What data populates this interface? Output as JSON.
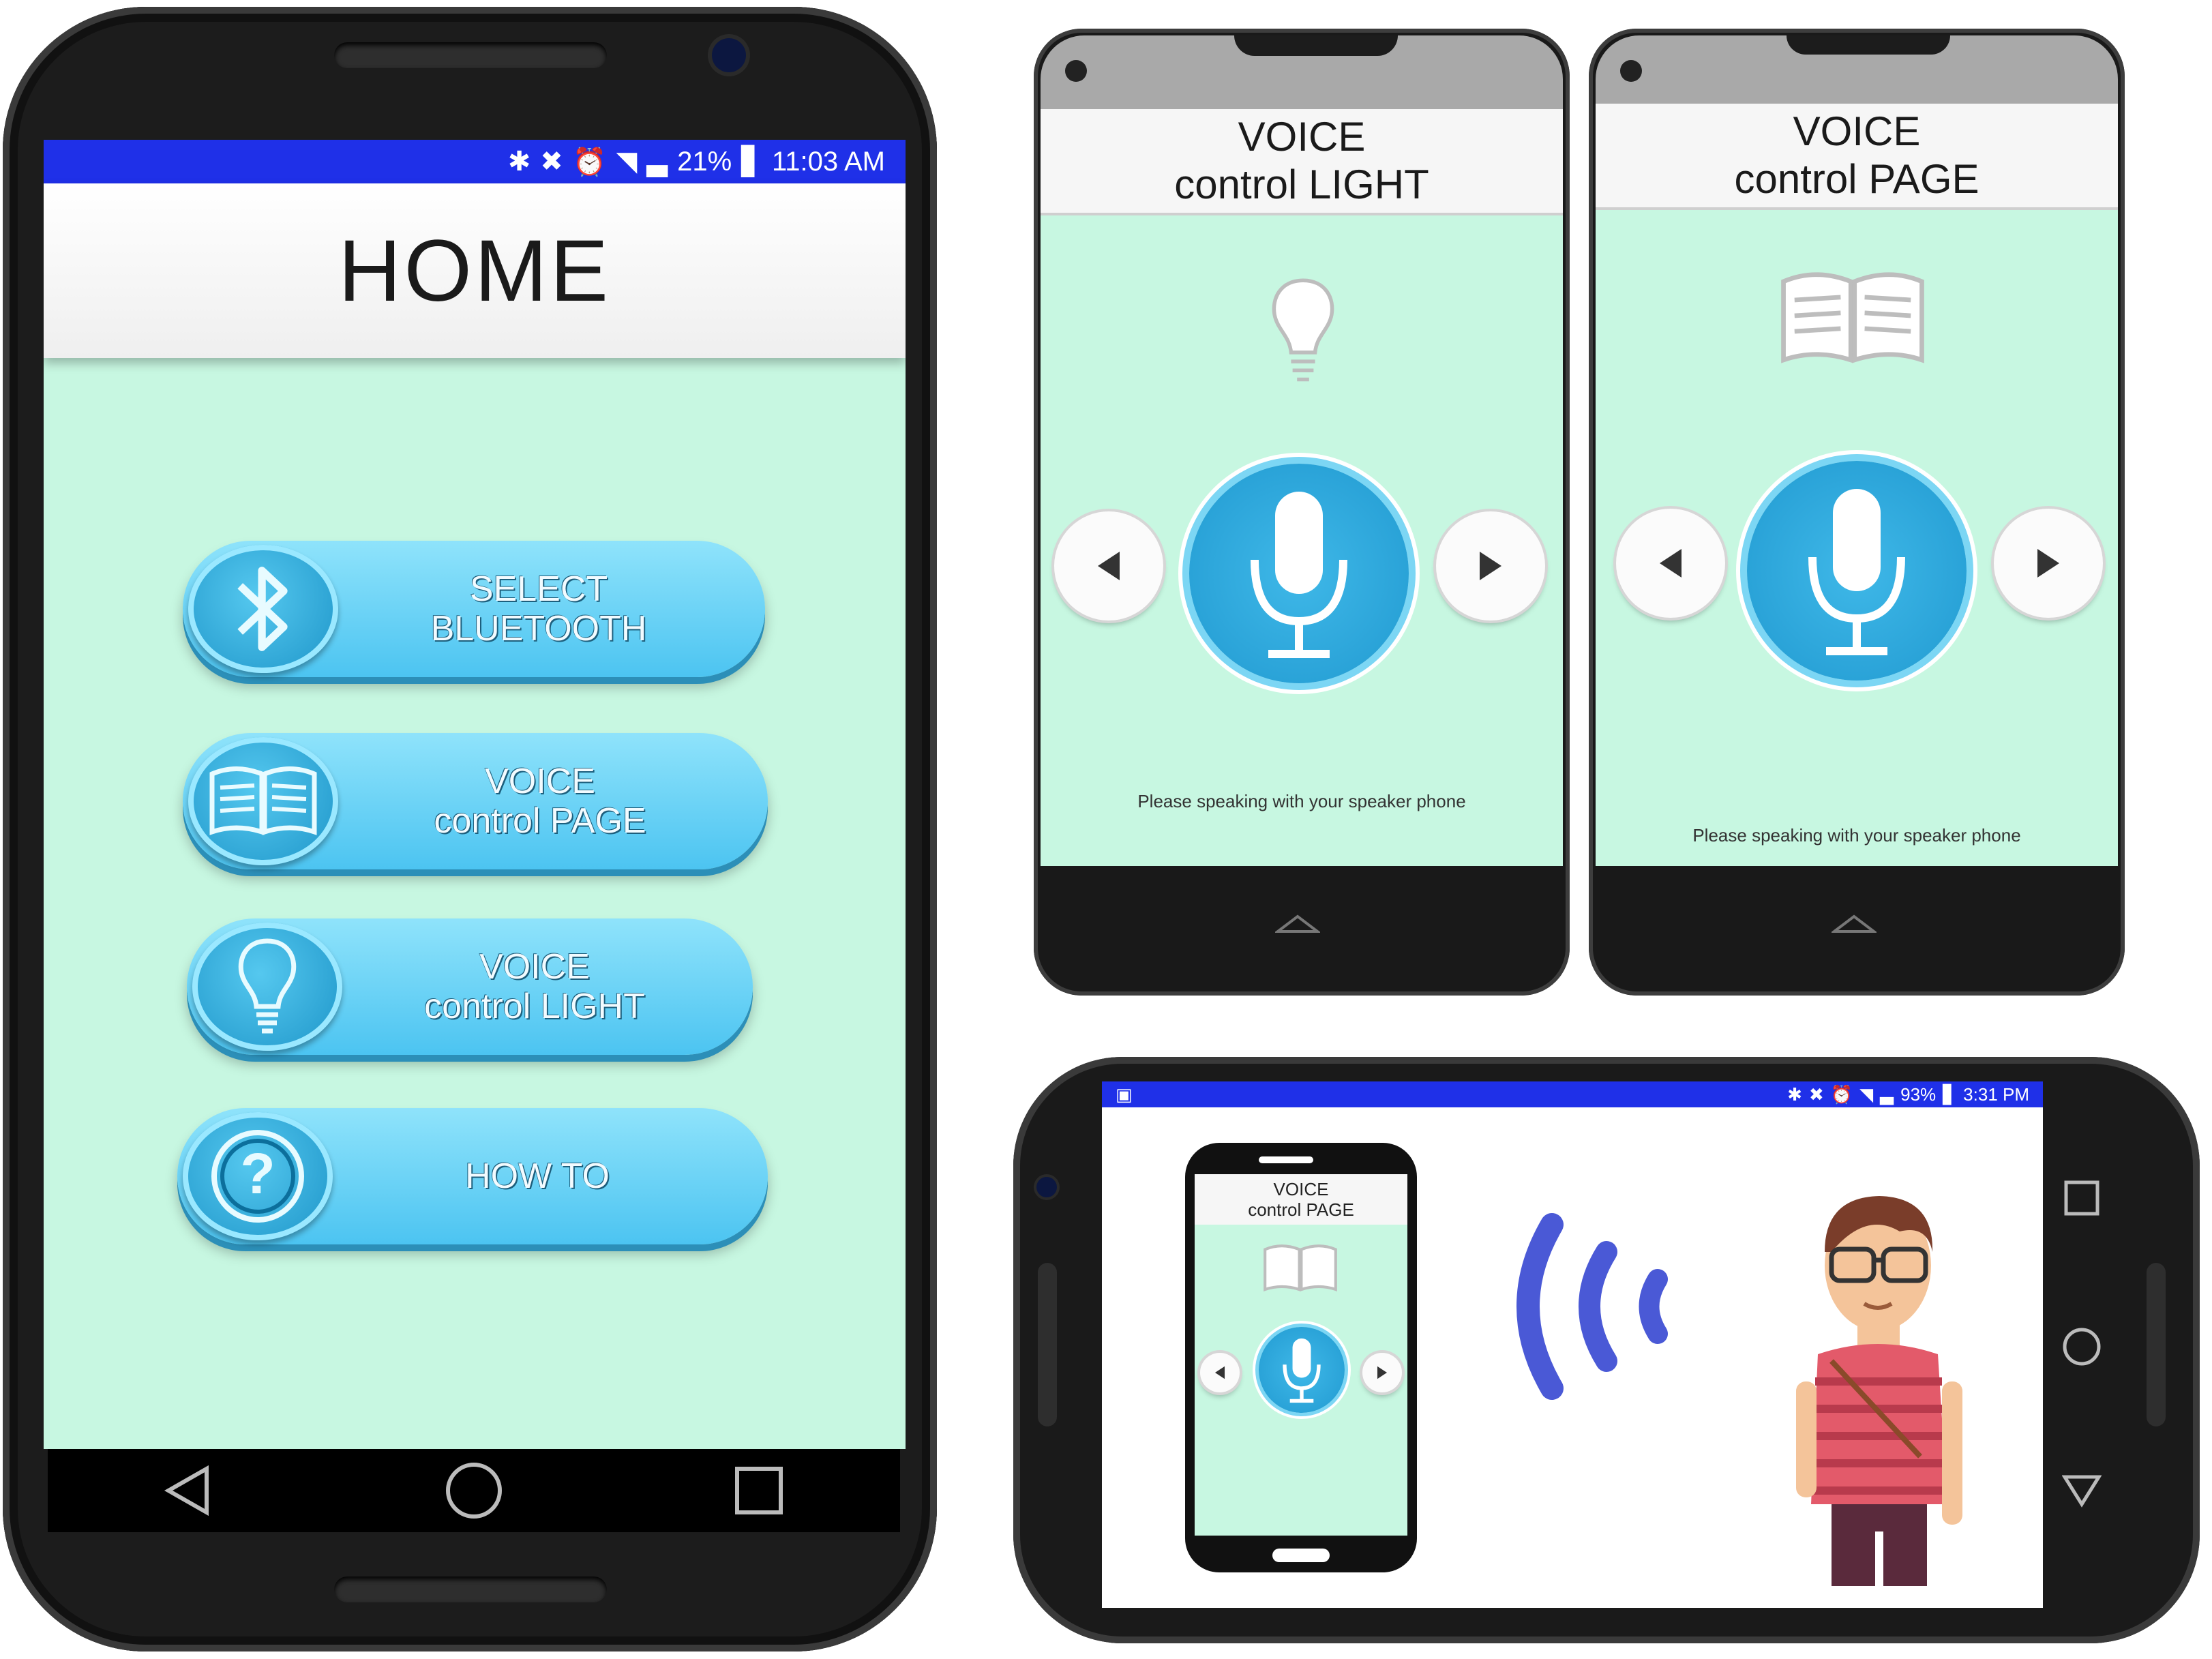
{
  "main_phone": {
    "status_bar": {
      "icons": [
        "bluetooth-icon",
        "mute-icon",
        "alarm-icon",
        "wifi-icon",
        "signal-icon"
      ],
      "battery": "21%",
      "time": "11:03 AM"
    },
    "title": "HOME",
    "buttons": [
      {
        "line1": "SELECT",
        "line2": "BLUETOOTH",
        "icon": "bluetooth-icon"
      },
      {
        "line1": "VOICE",
        "line2": "control PAGE",
        "icon": "book-icon"
      },
      {
        "line1": "VOICE",
        "line2": "control LIGHT",
        "icon": "lightbulb-icon"
      },
      {
        "line1": "HOW TO",
        "line2": "",
        "icon": "question-icon"
      }
    ],
    "nav": [
      "back-icon",
      "home-icon",
      "recents-icon"
    ]
  },
  "light_phone": {
    "title_line1": "VOICE",
    "title_line2": "control LIGHT",
    "hint": "Please speaking with your speaker phone"
  },
  "page_phone": {
    "title_line1": "VOICE",
    "title_line2": "control PAGE",
    "hint": "Please speaking with your speaker phone"
  },
  "landscape_phone": {
    "status_bar": {
      "battery": "93%",
      "time": "3:31 PM"
    },
    "inner_phone": {
      "title_line1": "VOICE",
      "title_line2": "control PAGE"
    }
  },
  "colors": {
    "status_blue": "#1f30e8",
    "screen_mint": "#c7f7e1",
    "button_blue": "#4cc4f1",
    "sound_wave": "#4a59d6"
  }
}
